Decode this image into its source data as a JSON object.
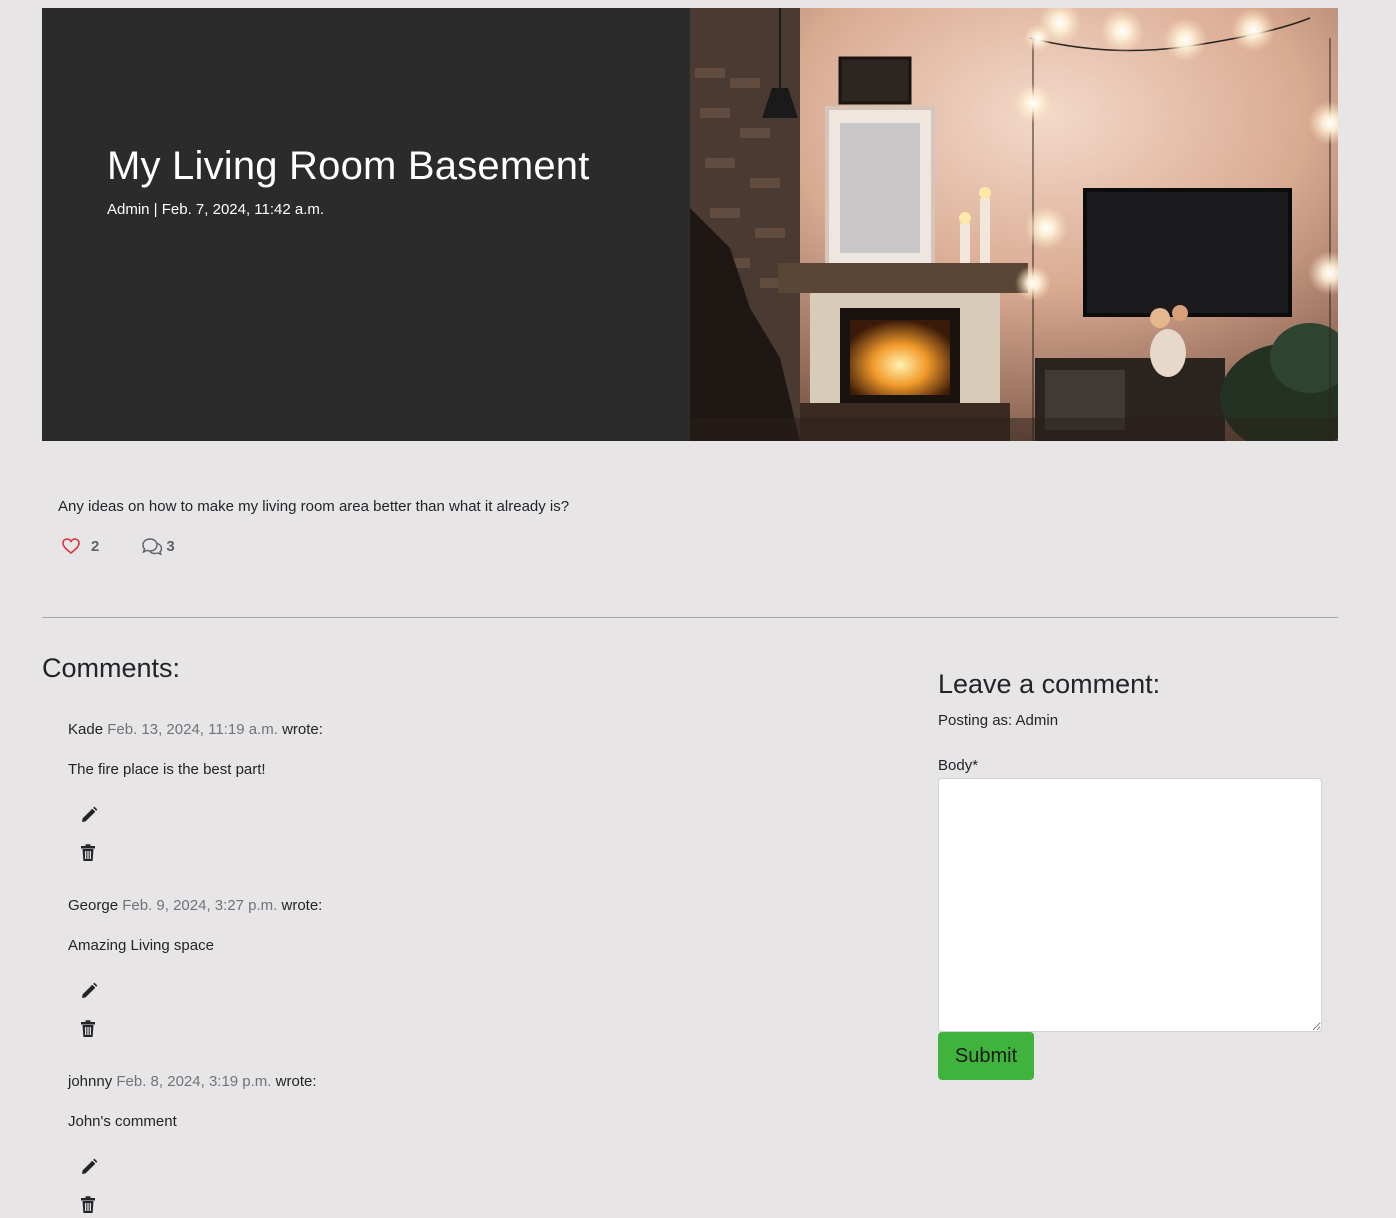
{
  "post": {
    "title": "My Living Room Basement",
    "meta": "Admin | Feb. 7, 2024, 11:42 a.m.",
    "excerpt": "Any ideas on how to make my living room area better than what it already is?",
    "likes": "2",
    "comment_count": "3",
    "image_description_icon": "living-room-photo"
  },
  "comments_section": {
    "heading": "Comments:",
    "items": [
      {
        "author": "Kade",
        "date": "Feb. 13, 2024, 11:19 a.m.",
        "suffix": "wrote:",
        "body": "The fire place is the best part!"
      },
      {
        "author": "George",
        "date": "Feb. 9, 2024, 3:27 p.m.",
        "suffix": "wrote:",
        "body": "Amazing Living space"
      },
      {
        "author": "johnny",
        "date": "Feb. 8, 2024, 3:19 p.m.",
        "suffix": "wrote:",
        "body": "John's comment"
      }
    ]
  },
  "form": {
    "heading": "Leave a comment:",
    "posting_as": "Posting as: Admin",
    "body_label": "Body*",
    "body_value": "",
    "submit_label": "Submit"
  },
  "colors": {
    "page_bg": "#e7e5e6",
    "hero_bg": "#2b2b2b",
    "submit_bg": "#3fb33b",
    "like_red": "#dc3545",
    "muted_date": "#6c757d"
  }
}
